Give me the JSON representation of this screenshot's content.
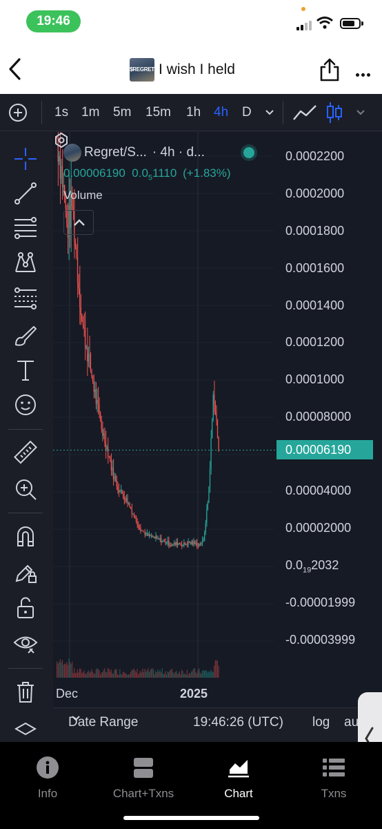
{
  "status_bar": {
    "time": "19:46"
  },
  "header": {
    "token_badge": "$REGRET",
    "title": "I wish I held"
  },
  "toolbar": {
    "add_label": "+",
    "intervals": [
      "1s",
      "1m",
      "5m",
      "15m",
      "1h",
      "4h",
      "D"
    ],
    "active_interval": "4h"
  },
  "legend": {
    "pair": "Regret/S...",
    "meta": "· 4h · d...",
    "price": "0.00006190",
    "change_prefix": "0.0",
    "change_sub": "5",
    "change_rest": "1110",
    "change_pct": "(+1.83%)",
    "volume_label": "Volume"
  },
  "price_axis": {
    "labels": [
      "0.0002200",
      "0.0002000",
      "0.0001800",
      "0.0001600",
      "0.0001400",
      "0.0001200",
      "0.0001000",
      "0.00008000",
      "0.00004000",
      "0.00002000",
      "-0.00001999",
      "-0.00003999"
    ],
    "special_prefix": "0.0",
    "special_sub": "19",
    "special_rest": "2032",
    "current": "0.00006190"
  },
  "time_axis": {
    "labels": [
      "Dec",
      "2025"
    ]
  },
  "bottom_strip": {
    "date_range": "Date Range",
    "clock": "19:46:26 (UTC)",
    "log": "log",
    "auto": "au"
  },
  "tabs": [
    {
      "label": "Info",
      "icon": "info-icon"
    },
    {
      "label": "Chart+Txns",
      "icon": "split-view-icon"
    },
    {
      "label": "Chart",
      "icon": "chart-icon"
    },
    {
      "label": "Txns",
      "icon": "list-icon"
    }
  ],
  "active_tab": "Chart",
  "colors": {
    "up": "#26a69a",
    "down": "#ef5350",
    "active": "#2962ff",
    "bg": "#161a25"
  },
  "chart_data": {
    "type": "line",
    "title": "",
    "xlabel": "",
    "ylabel": "",
    "x_ticks": [
      "Dec",
      "2025"
    ],
    "ylim": [
      -4e-05,
      0.00023
    ],
    "last_price": 6.19e-05,
    "series": [
      {
        "values": [
          0.00023,
          0.00021,
          0.00018,
          0.000195,
          0.00016,
          0.00013,
          0.000115,
          0.0001,
          8.5e-05,
          7.2e-05,
          6.2e-05,
          5e-05,
          4.2e-05,
          3.8e-05,
          3.4e-05,
          2.8e-05,
          2.2e-05,
          1.8e-05,
          1.6e-05,
          1.5e-05,
          1.4e-05,
          1.3e-05,
          1.2e-05,
          1.1e-05,
          1.2e-05,
          1.1e-05,
          1.2e-05,
          1.2e-05,
          1.1e-05,
          1.3e-05,
          3.8e-05,
          9.5e-05,
          6.19e-05
        ]
      }
    ]
  }
}
